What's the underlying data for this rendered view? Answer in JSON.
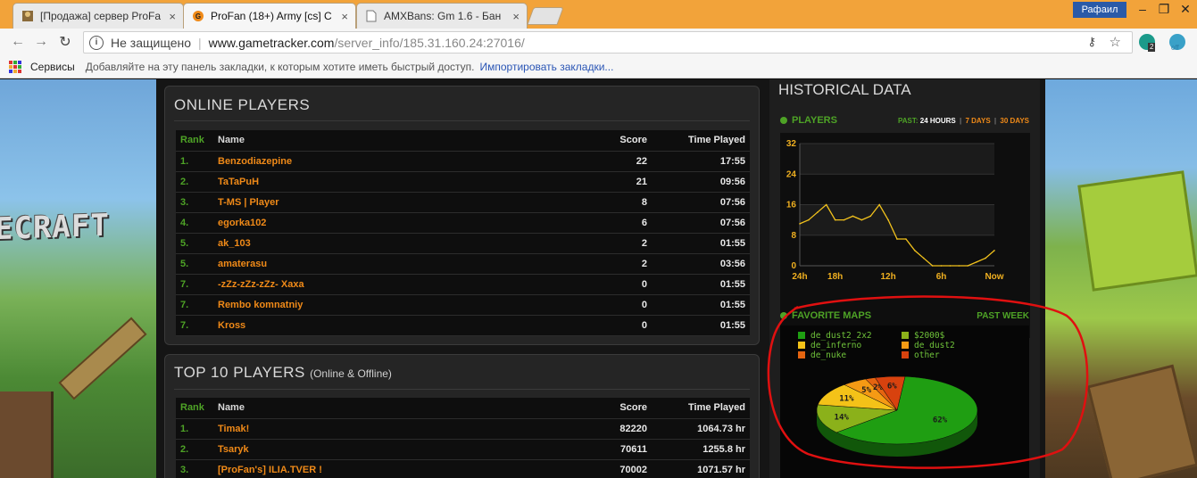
{
  "browser": {
    "tabs": [
      {
        "title": "[Продажа] сервер ProFa",
        "active": false
      },
      {
        "title": "ProFan (18+) Army [cs] С",
        "active": true
      },
      {
        "title": "AMXBans: Gm 1.6 - Бан",
        "active": false
      }
    ],
    "user_name": "Рафаил",
    "address": {
      "security_label": "Не защищено",
      "host": "www.gametracker.com",
      "path": "/server_info/185.31.160.24:27016/"
    },
    "extension_badge": "2",
    "extension_badge2": "off",
    "bookmarks": {
      "apps_label": "Сервисы",
      "hint": "Добавляйте на эту панель закладки, к которым хотите иметь быстрый доступ.",
      "import_link": "Импортировать закладки..."
    }
  },
  "background": {
    "logo_text": "ECRAFT"
  },
  "online_players": {
    "title": "ONLINE PLAYERS",
    "headers": {
      "rank": "Rank",
      "name": "Name",
      "score": "Score",
      "time": "Time Played"
    },
    "rows": [
      {
        "rank": "1.",
        "name": "Benzodiazepine",
        "score": "22",
        "time": "17:55"
      },
      {
        "rank": "2.",
        "name": "TaTaPuH",
        "score": "21",
        "time": "09:56"
      },
      {
        "rank": "3.",
        "name": "T-MS | Player",
        "score": "8",
        "time": "07:56"
      },
      {
        "rank": "4.",
        "name": "egorka102",
        "score": "6",
        "time": "07:56"
      },
      {
        "rank": "5.",
        "name": "ak_103",
        "score": "2",
        "time": "01:55"
      },
      {
        "rank": "5.",
        "name": "amaterasu",
        "score": "2",
        "time": "03:56"
      },
      {
        "rank": "7.",
        "name": "-zZz-zZz-zZz- Xaxa",
        "score": "0",
        "time": "01:55"
      },
      {
        "rank": "7.",
        "name": "Rembo komnatniy",
        "score": "0",
        "time": "01:55"
      },
      {
        "rank": "7.",
        "name": "Kross",
        "score": "0",
        "time": "01:55"
      }
    ]
  },
  "top_players": {
    "title": "TOP 10 PLAYERS",
    "subtitle": "(Online & Offline)",
    "headers": {
      "rank": "Rank",
      "name": "Name",
      "score": "Score",
      "time": "Time Played"
    },
    "rows": [
      {
        "rank": "1.",
        "name": "Timak!",
        "score": "82220",
        "time": "1064.73 hr"
      },
      {
        "rank": "2.",
        "name": "Tsaryk",
        "score": "70611",
        "time": "1255.8 hr"
      },
      {
        "rank": "3.",
        "name": "[ProFan's] ILIA.TVER !",
        "score": "70002",
        "time": "1071.57 hr"
      }
    ]
  },
  "historical": {
    "title": "HISTORICAL DATA",
    "players_label": "PLAYERS",
    "range": {
      "prefix": "PAST:",
      "current": "24 HOURS",
      "options": [
        "7 DAYS",
        "30 DAYS"
      ]
    },
    "favorite_maps_label": "FAVORITE MAPS",
    "past_week": "PAST WEEK"
  },
  "chart_data": [
    {
      "type": "line",
      "x": [
        "24h",
        "",
        "",
        "",
        "18h",
        "",
        "",
        "",
        "",
        "",
        "12h",
        "",
        "",
        "",
        "",
        "",
        "6h",
        "",
        "",
        "",
        "",
        "",
        "Now"
      ],
      "y": [
        11,
        12,
        14,
        16,
        12,
        12,
        13,
        12,
        13,
        16,
        12,
        7,
        7,
        4,
        2,
        0,
        0,
        0,
        0,
        0,
        1,
        2,
        4
      ],
      "ylim": [
        0,
        32
      ],
      "yticks": [
        "0",
        "8",
        "16",
        "24",
        "32"
      ],
      "xticks": [
        "24h",
        "18h",
        "12h",
        "6h",
        "Now"
      ],
      "grid": true,
      "line_color": "#f2c21c"
    },
    {
      "type": "pie",
      "labels": [
        "de_dust2_2x2",
        "$2000$",
        "de_inferno",
        "de_dust2",
        "de_nuke",
        "other"
      ],
      "values": [
        62,
        14,
        11,
        5,
        2,
        6
      ],
      "value_labels": [
        "62%",
        "14%",
        "11%",
        "5%",
        "2%",
        "6%"
      ],
      "colors": [
        "#1f9e12",
        "#8bb11a",
        "#f4c218",
        "#f59a14",
        "#e56410",
        "#d8420e"
      ],
      "legend_position": "top"
    }
  ]
}
